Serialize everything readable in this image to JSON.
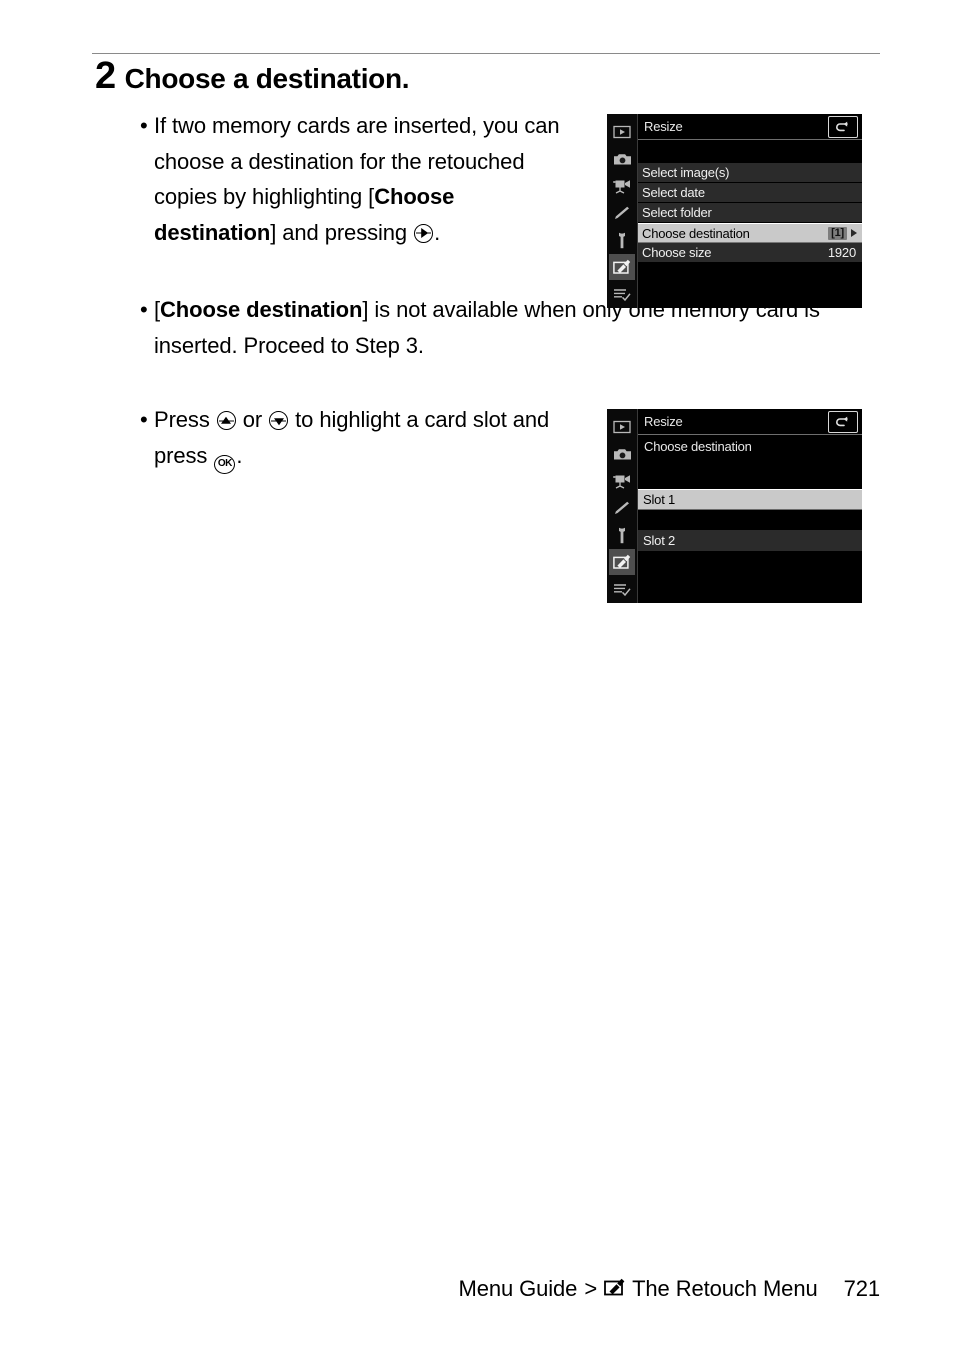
{
  "step": {
    "number": "2",
    "title": "Choose a destination."
  },
  "bullets": [
    {
      "id": "bullet-two-cards",
      "parts": [
        {
          "t": "text",
          "v": "If two memory cards are inserted, you can choose a destination for the retouched copies by highlighting ["
        },
        {
          "t": "bold",
          "v": "Choose destination"
        },
        {
          "t": "text",
          "v": "] and pressing "
        },
        {
          "t": "icon",
          "v": "multi-selector-right-icon"
        },
        {
          "t": "text",
          "v": "."
        }
      ]
    },
    {
      "id": "bullet-not-available",
      "parts": [
        {
          "t": "text",
          "v": "["
        },
        {
          "t": "bold",
          "v": "Choose destination"
        },
        {
          "t": "text",
          "v": "] is not available when only one memory card is inserted. Proceed to Step 3."
        }
      ]
    },
    {
      "id": "bullet-press-ok",
      "parts": [
        {
          "t": "text",
          "v": "Press "
        },
        {
          "t": "icon",
          "v": "multi-selector-up-icon"
        },
        {
          "t": "text",
          "v": " or "
        },
        {
          "t": "icon",
          "v": "multi-selector-down-icon"
        },
        {
          "t": "text",
          "v": " to highlight a card slot and press "
        },
        {
          "t": "icon",
          "v": "ok-button-icon"
        },
        {
          "t": "text",
          "v": "."
        }
      ]
    }
  ],
  "bullet_marker": "•",
  "lcd_sidebar_icons": [
    {
      "name": "playback-menu-icon",
      "active": false
    },
    {
      "name": "photo-shooting-menu-icon",
      "active": false
    },
    {
      "name": "video-recording-menu-icon",
      "active": false
    },
    {
      "name": "custom-settings-menu-icon",
      "active": false
    },
    {
      "name": "setup-menu-icon",
      "active": false
    },
    {
      "name": "retouch-menu-icon",
      "active": true
    },
    {
      "name": "my-menu-icon",
      "active": false
    }
  ],
  "lcd_resize_menu": {
    "title": "Resize",
    "back_icon": "back-arrow-icon",
    "rows": [
      {
        "label": "Select image(s)",
        "value": "",
        "selected": false
      },
      {
        "label": "Select date",
        "value": "",
        "selected": false
      },
      {
        "label": "Select folder",
        "value": "",
        "selected": false
      },
      {
        "label": "Choose destination",
        "value": "",
        "badge": "1",
        "arrow": true,
        "selected": true
      },
      {
        "label": "Choose size",
        "value": "1920",
        "selected": false
      }
    ]
  },
  "lcd_destination_menu": {
    "title": "Resize",
    "back_icon": "back-arrow-icon",
    "subtitle": "Choose destination",
    "options": [
      {
        "label": "Slot 1",
        "selected": true
      },
      {
        "label": "Slot 2",
        "selected": false
      }
    ]
  },
  "footer": {
    "breadcrumb_root": "Menu Guide",
    "separator": ">",
    "section_icon": "retouch-menu-icon",
    "section": "The Retouch Menu",
    "page_number": "721"
  },
  "colors": {
    "page_background": "#ffffff",
    "text": "#000000",
    "rule": "#8a8a8a",
    "lcd_background": "#000000",
    "lcd_row": "#2b2b2b",
    "lcd_highlight": "#c9c9c9",
    "lcd_text": "#f0f0f0"
  }
}
